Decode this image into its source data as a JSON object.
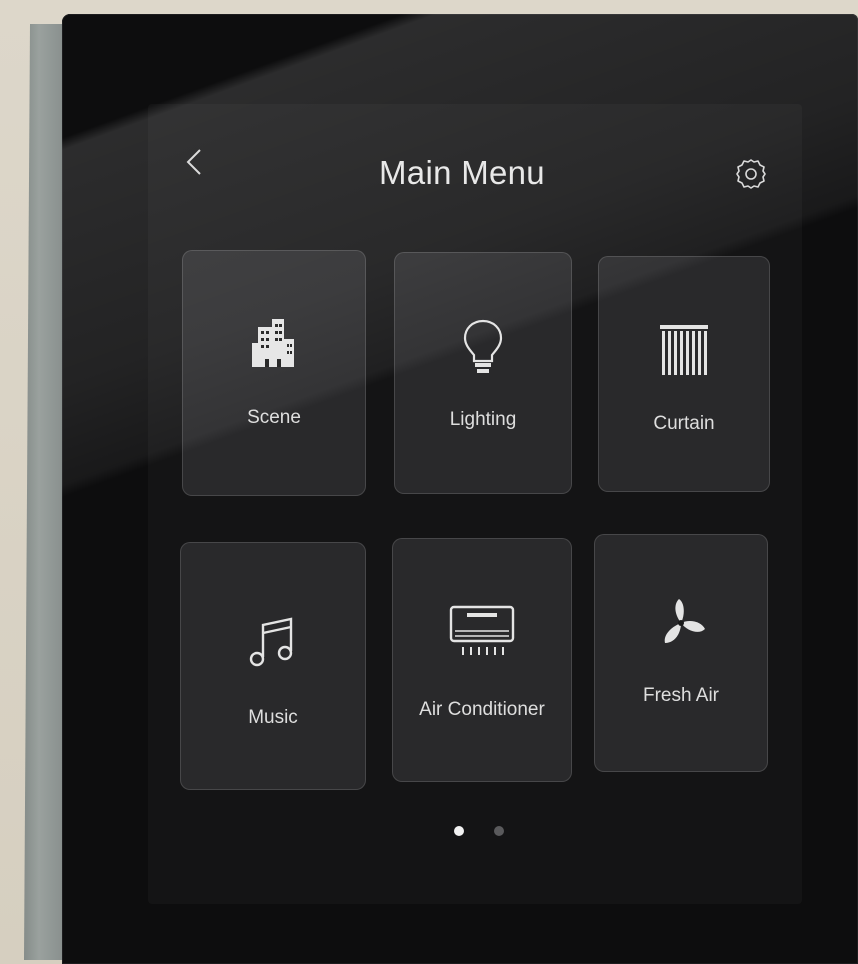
{
  "header": {
    "title": "Main Menu",
    "back_icon": "chevron-left-icon",
    "settings_icon": "gear-icon"
  },
  "tiles": [
    {
      "label": "Scene",
      "icon": "buildings-icon"
    },
    {
      "label": "Lighting",
      "icon": "light-bulb-icon"
    },
    {
      "label": "Curtain",
      "icon": "curtain-icon"
    },
    {
      "label": "Music",
      "icon": "music-note-icon"
    },
    {
      "label": "Air Conditioner",
      "icon": "air-conditioner-icon"
    },
    {
      "label": "Fresh Air",
      "icon": "fan-icon"
    }
  ],
  "pagination": {
    "pages": 2,
    "active": 1
  },
  "colors": {
    "panel": "#0d0d0e",
    "text": "#e6e6e6",
    "tile_bg": "rgba(120,120,122,0.22)"
  }
}
